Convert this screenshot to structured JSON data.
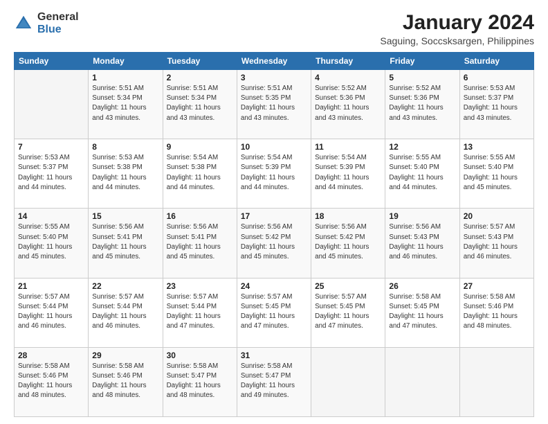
{
  "header": {
    "logo_general": "General",
    "logo_blue": "Blue",
    "main_title": "January 2024",
    "subtitle": "Saguing, Soccsksargen, Philippines"
  },
  "columns": [
    "Sunday",
    "Monday",
    "Tuesday",
    "Wednesday",
    "Thursday",
    "Friday",
    "Saturday"
  ],
  "weeks": [
    [
      {
        "day": "",
        "info": ""
      },
      {
        "day": "1",
        "info": "Sunrise: 5:51 AM\nSunset: 5:34 PM\nDaylight: 11 hours\nand 43 minutes."
      },
      {
        "day": "2",
        "info": "Sunrise: 5:51 AM\nSunset: 5:34 PM\nDaylight: 11 hours\nand 43 minutes."
      },
      {
        "day": "3",
        "info": "Sunrise: 5:51 AM\nSunset: 5:35 PM\nDaylight: 11 hours\nand 43 minutes."
      },
      {
        "day": "4",
        "info": "Sunrise: 5:52 AM\nSunset: 5:36 PM\nDaylight: 11 hours\nand 43 minutes."
      },
      {
        "day": "5",
        "info": "Sunrise: 5:52 AM\nSunset: 5:36 PM\nDaylight: 11 hours\nand 43 minutes."
      },
      {
        "day": "6",
        "info": "Sunrise: 5:53 AM\nSunset: 5:37 PM\nDaylight: 11 hours\nand 43 minutes."
      }
    ],
    [
      {
        "day": "7",
        "info": "Sunrise: 5:53 AM\nSunset: 5:37 PM\nDaylight: 11 hours\nand 44 minutes."
      },
      {
        "day": "8",
        "info": "Sunrise: 5:53 AM\nSunset: 5:38 PM\nDaylight: 11 hours\nand 44 minutes."
      },
      {
        "day": "9",
        "info": "Sunrise: 5:54 AM\nSunset: 5:38 PM\nDaylight: 11 hours\nand 44 minutes."
      },
      {
        "day": "10",
        "info": "Sunrise: 5:54 AM\nSunset: 5:39 PM\nDaylight: 11 hours\nand 44 minutes."
      },
      {
        "day": "11",
        "info": "Sunrise: 5:54 AM\nSunset: 5:39 PM\nDaylight: 11 hours\nand 44 minutes."
      },
      {
        "day": "12",
        "info": "Sunrise: 5:55 AM\nSunset: 5:40 PM\nDaylight: 11 hours\nand 44 minutes."
      },
      {
        "day": "13",
        "info": "Sunrise: 5:55 AM\nSunset: 5:40 PM\nDaylight: 11 hours\nand 45 minutes."
      }
    ],
    [
      {
        "day": "14",
        "info": "Sunrise: 5:55 AM\nSunset: 5:40 PM\nDaylight: 11 hours\nand 45 minutes."
      },
      {
        "day": "15",
        "info": "Sunrise: 5:56 AM\nSunset: 5:41 PM\nDaylight: 11 hours\nand 45 minutes."
      },
      {
        "day": "16",
        "info": "Sunrise: 5:56 AM\nSunset: 5:41 PM\nDaylight: 11 hours\nand 45 minutes."
      },
      {
        "day": "17",
        "info": "Sunrise: 5:56 AM\nSunset: 5:42 PM\nDaylight: 11 hours\nand 45 minutes."
      },
      {
        "day": "18",
        "info": "Sunrise: 5:56 AM\nSunset: 5:42 PM\nDaylight: 11 hours\nand 45 minutes."
      },
      {
        "day": "19",
        "info": "Sunrise: 5:56 AM\nSunset: 5:43 PM\nDaylight: 11 hours\nand 46 minutes."
      },
      {
        "day": "20",
        "info": "Sunrise: 5:57 AM\nSunset: 5:43 PM\nDaylight: 11 hours\nand 46 minutes."
      }
    ],
    [
      {
        "day": "21",
        "info": "Sunrise: 5:57 AM\nSunset: 5:44 PM\nDaylight: 11 hours\nand 46 minutes."
      },
      {
        "day": "22",
        "info": "Sunrise: 5:57 AM\nSunset: 5:44 PM\nDaylight: 11 hours\nand 46 minutes."
      },
      {
        "day": "23",
        "info": "Sunrise: 5:57 AM\nSunset: 5:44 PM\nDaylight: 11 hours\nand 47 minutes."
      },
      {
        "day": "24",
        "info": "Sunrise: 5:57 AM\nSunset: 5:45 PM\nDaylight: 11 hours\nand 47 minutes."
      },
      {
        "day": "25",
        "info": "Sunrise: 5:57 AM\nSunset: 5:45 PM\nDaylight: 11 hours\nand 47 minutes."
      },
      {
        "day": "26",
        "info": "Sunrise: 5:58 AM\nSunset: 5:45 PM\nDaylight: 11 hours\nand 47 minutes."
      },
      {
        "day": "27",
        "info": "Sunrise: 5:58 AM\nSunset: 5:46 PM\nDaylight: 11 hours\nand 48 minutes."
      }
    ],
    [
      {
        "day": "28",
        "info": "Sunrise: 5:58 AM\nSunset: 5:46 PM\nDaylight: 11 hours\nand 48 minutes."
      },
      {
        "day": "29",
        "info": "Sunrise: 5:58 AM\nSunset: 5:46 PM\nDaylight: 11 hours\nand 48 minutes."
      },
      {
        "day": "30",
        "info": "Sunrise: 5:58 AM\nSunset: 5:47 PM\nDaylight: 11 hours\nand 48 minutes."
      },
      {
        "day": "31",
        "info": "Sunrise: 5:58 AM\nSunset: 5:47 PM\nDaylight: 11 hours\nand 49 minutes."
      },
      {
        "day": "",
        "info": ""
      },
      {
        "day": "",
        "info": ""
      },
      {
        "day": "",
        "info": ""
      }
    ]
  ]
}
